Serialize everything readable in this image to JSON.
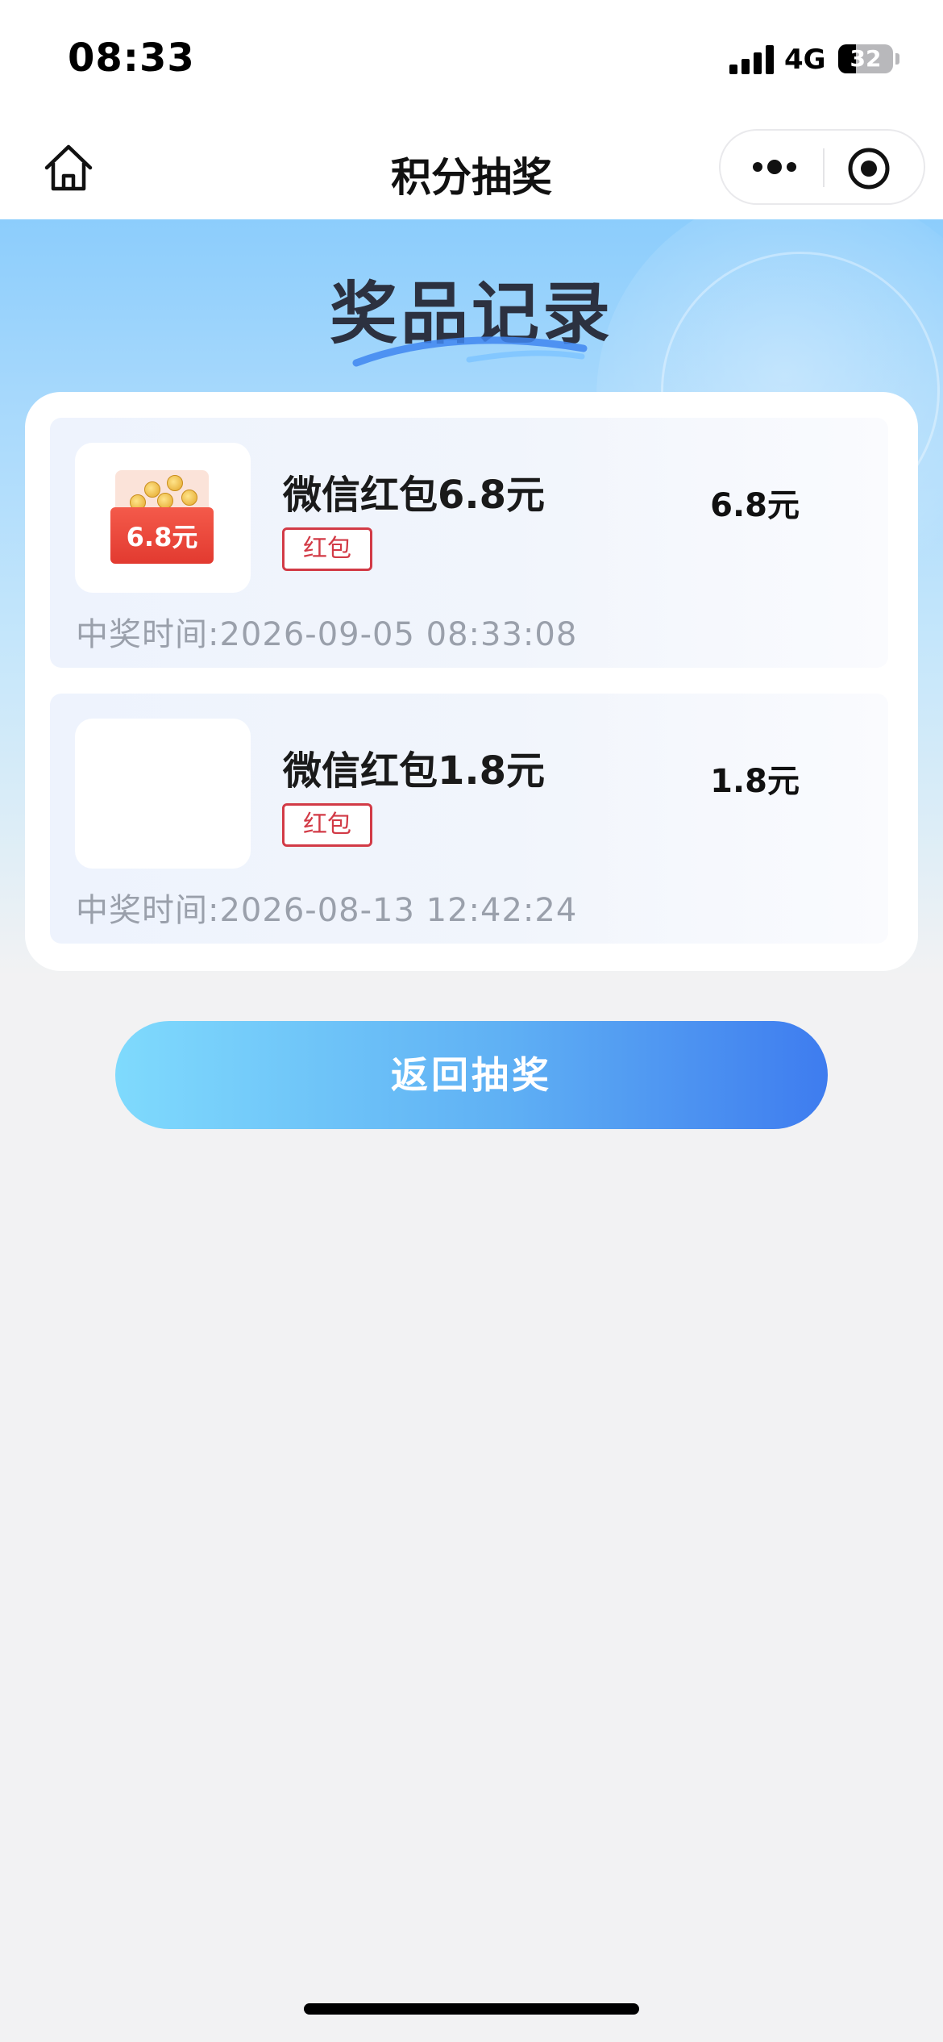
{
  "status_bar": {
    "time": "08:33",
    "network": "4G",
    "battery_percent": 32
  },
  "nav": {
    "title": "积分抽奖",
    "home_icon": "home-icon",
    "more_icon": "more-dots-icon",
    "target_icon": "target-icon"
  },
  "hero": {
    "title": "奖品记录"
  },
  "records": [
    {
      "name": "微信红包6.8元",
      "tag": "红包",
      "amount": "6.8元",
      "time": "中奖时间:2026-09-05 08:33:08",
      "thumb_label": "6.8元",
      "has_image": true
    },
    {
      "name": "微信红包1.8元",
      "tag": "红包",
      "amount": "1.8元",
      "time": "中奖时间:2026-08-13 12:42:24",
      "has_image": false
    }
  ],
  "return_button": {
    "label": "返回抽奖"
  },
  "colors": {
    "tag_red": "#d23a46",
    "button_start": "#7fdafd",
    "button_end": "#3e7cef",
    "hero_top": "#8ccdfc"
  }
}
